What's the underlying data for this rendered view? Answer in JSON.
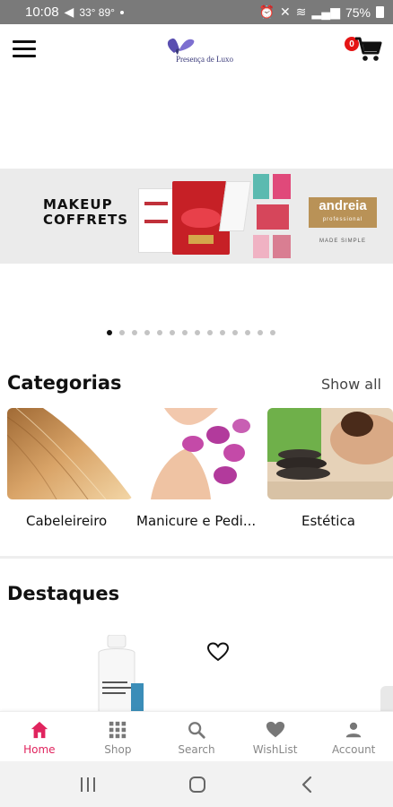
{
  "status_bar": {
    "time": "10:08",
    "temps": "33° 89°",
    "battery": "75%"
  },
  "header": {
    "logo_text": "Presença de Luxo",
    "cart_count": "0"
  },
  "banner": {
    "headline_line1": "MAKEUP",
    "headline_line2": "COFFRETS",
    "brand_name": "andreia",
    "brand_sub": "professional",
    "brand_tagline": "MADE SIMPLE",
    "slide_count": 14,
    "active_slide": 1
  },
  "categories": {
    "title": "Categorias",
    "show_all": "Show all",
    "items": [
      {
        "label": "Cabeleireiro",
        "icon": "hair-image"
      },
      {
        "label": "Manicure e Pedi...",
        "icon": "nails-orchid-image"
      },
      {
        "label": "Estética",
        "icon": "spa-stones-image"
      }
    ]
  },
  "featured": {
    "title": "Destaques"
  },
  "bottom_nav": {
    "items": [
      {
        "label": "Home",
        "icon": "home-icon",
        "active": true
      },
      {
        "label": "Shop",
        "icon": "grid-icon",
        "active": false
      },
      {
        "label": "Search",
        "icon": "search-icon",
        "active": false
      },
      {
        "label": "WishList",
        "icon": "heart-icon",
        "active": false
      },
      {
        "label": "Account",
        "icon": "person-icon",
        "active": false
      }
    ]
  },
  "colors": {
    "accent": "#e0245e",
    "badge": "#e51515",
    "brand_gold": "#b99257"
  }
}
